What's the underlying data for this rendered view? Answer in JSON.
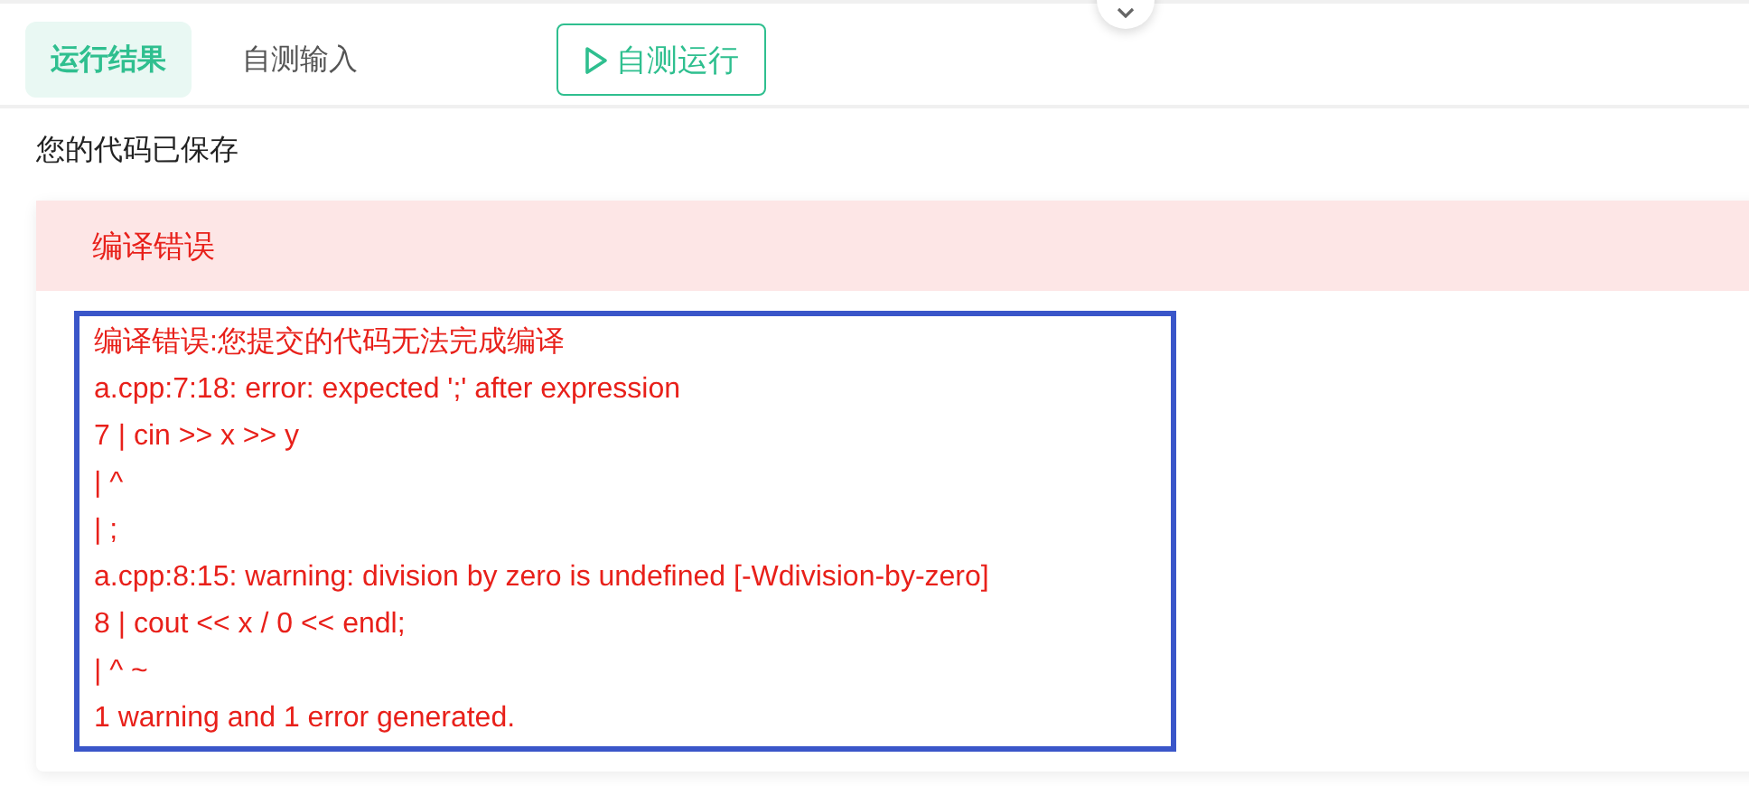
{
  "tabs": [
    {
      "label": "运行结果",
      "selected": true
    },
    {
      "label": "自测输入",
      "selected": false
    }
  ],
  "run_button": {
    "label": "自测运行"
  },
  "save_status": "您的代码已保存",
  "result": {
    "title": "编译错误",
    "output": [
      "编译错误:您提交的代码无法完成编译",
      "a.cpp:7:18: error: expected ';' after expression",
      "7 | cin >> x >> y",
      "| ^",
      "| ;",
      "a.cpp:8:15: warning: division by zero is undefined [-Wdivision-by-zero]",
      "8 | cout << x / 0 << endl;",
      "| ^ ~",
      "1 warning and 1 error generated."
    ]
  }
}
